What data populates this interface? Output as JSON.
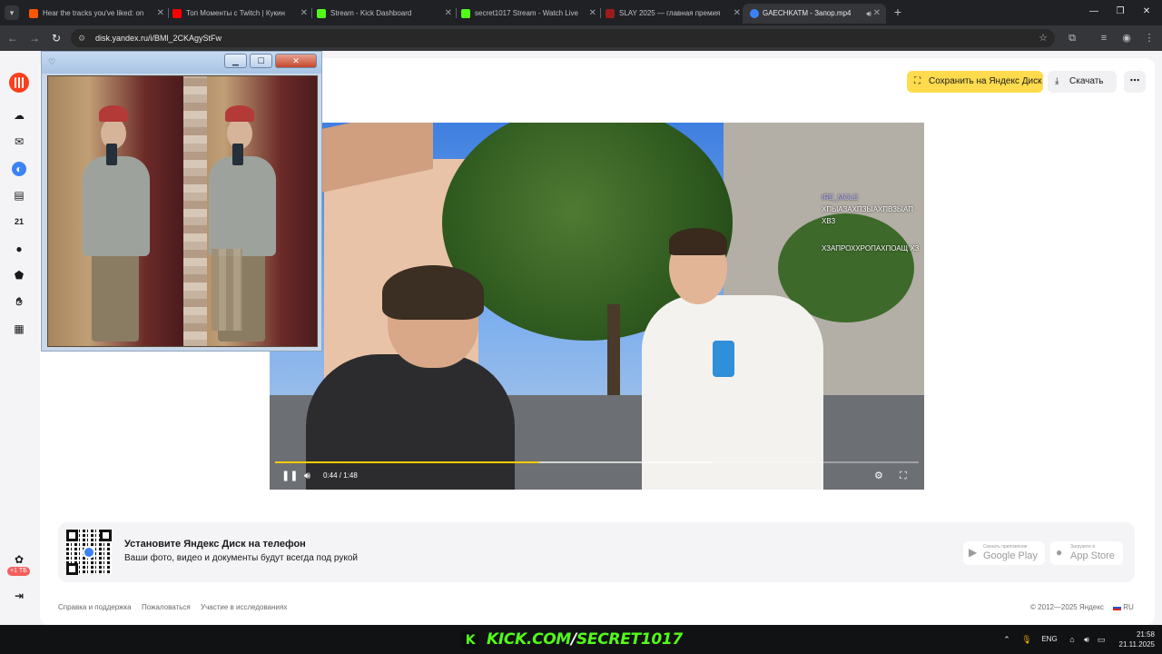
{
  "browser": {
    "tabs": [
      {
        "title": "Hear the tracks you've liked: on",
        "favicon_color": "#ff5500"
      },
      {
        "title": "Топ Моменты с Twitch | Кукин",
        "favicon_color": "#ff0000"
      },
      {
        "title": "Stream - Kick Dashboard",
        "favicon_color": "#53fc18"
      },
      {
        "title": "secret1017 Stream - Watch Live",
        "favicon_color": "#53fc18"
      },
      {
        "title": "SLAY 2025 — главная премия",
        "favicon_color": "#9b1b1b"
      },
      {
        "title": "GAECHKATM - Запор.mp4",
        "favicon_color": "#3b82f6"
      }
    ],
    "url": "disk.yandex.ru/i/BMl_2CKAgyStFw"
  },
  "toolbar": {
    "save_label": "Сохранить на Яндекс Диск",
    "download_label": "Скачать",
    "more_label": "⋯"
  },
  "rail": {
    "badge": "+1 ТБ"
  },
  "video": {
    "time": "0:44 / 1:48",
    "progress": 0.41,
    "buffered": 0.68,
    "chat": [
      {
        "user": "IRE_MOLE",
        "message": "ХПЫАЗАХПЗЫАХПВЗЫАП ХВЗ"
      },
      {
        "user": "",
        "message": "ХЗАПРОХХРОПАХПОАЩ ХЗ"
      }
    ]
  },
  "promo": {
    "title": "Установите Яндекс Диск на телефон",
    "subtitle": "Ваши фото, видео и документы будут всегда под рукой",
    "google_small": "Скачать приложение",
    "google_big": "Google Play",
    "apple_small": "Загрузите в",
    "apple_big": "App Store"
  },
  "footer": {
    "links": [
      "Справка и поддержка",
      "Пожаловаться",
      "Участие в исследованиях"
    ],
    "copyright": "© 2012—2025 Яндекс",
    "lang": "RU"
  },
  "overlay": {
    "kick_domain": "KICK.COM",
    "kick_slash": "/",
    "kick_channel": "SECRET1017",
    "kick_logo": "K"
  },
  "taskbar": {
    "lang": "ENG",
    "time": "21:58",
    "date": "21.11.2025"
  }
}
